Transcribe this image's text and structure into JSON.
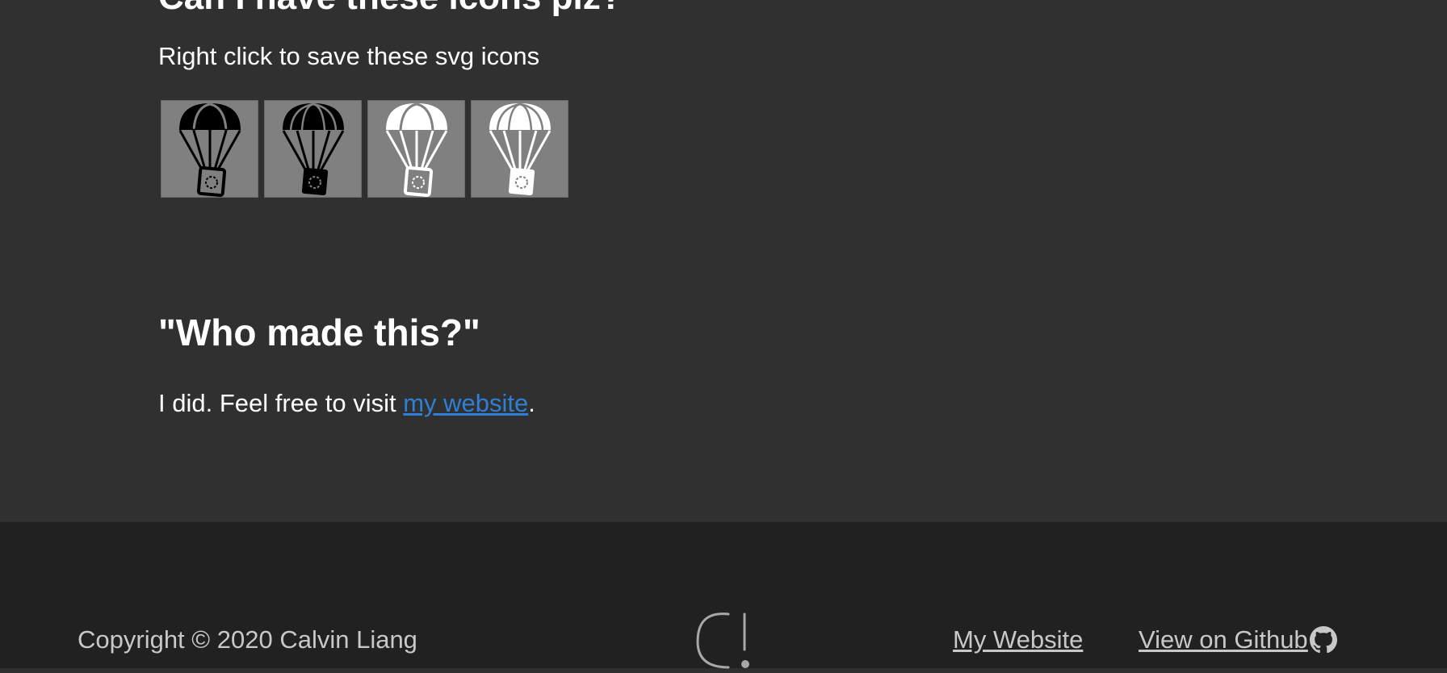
{
  "main": {
    "cut_heading": "Can I have these icons plz?",
    "instruction": "Right click to save these svg icons",
    "icons": [
      {
        "name": "parachute-black-outline-icon",
        "style": "black-outline"
      },
      {
        "name": "parachute-black-filled-icon",
        "style": "black-filled"
      },
      {
        "name": "parachute-white-outline-icon",
        "style": "white-outline"
      },
      {
        "name": "parachute-white-filled-icon",
        "style": "white-filled"
      }
    ],
    "who_heading": "\"Who made this?\"",
    "visit_prefix": "I did. Feel free to visit ",
    "visit_link": "my website",
    "visit_suffix": "."
  },
  "footer": {
    "copyright": "Copyright © 2020 Calvin Liang",
    "logo_icon": "calvin-logo-icon",
    "links": {
      "website": "My Website",
      "github": "View on Github"
    },
    "github_icon": "github-icon"
  },
  "colors": {
    "page_bg": "#303030",
    "footer_bg": "#212121",
    "link_blue": "#2f7fd6",
    "tile_bg": "#808080",
    "footer_text": "#c8c8c8"
  }
}
